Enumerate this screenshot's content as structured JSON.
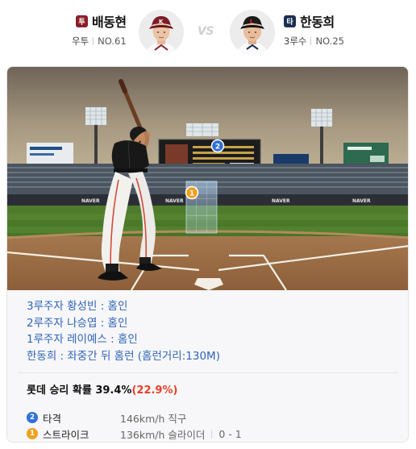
{
  "matchup": {
    "pitcher": {
      "role": "투",
      "name": "배동현",
      "position": "우투",
      "number": "NO.61",
      "role_color": "#8a1f2c"
    },
    "vs": "VS",
    "batter": {
      "role": "타",
      "name": "한동희",
      "position": "3루수",
      "number": "NO.25",
      "role_color": "#1b2f52"
    }
  },
  "stadium": {
    "pitch_markers": [
      {
        "label": "2",
        "color": "#2f6fd8"
      },
      {
        "label": "1",
        "color": "#f0a020"
      }
    ],
    "signs": [
      "NAVER",
      "NAVER",
      "NAVER",
      "NAVER"
    ]
  },
  "events": [
    "3루주자 황성빈 : 홈인",
    "2루주자 나승엽 : 홈인",
    "1루주자 레이예스 : 홈인",
    "한동희 : 좌중간 뒤 홈런 (홈런거리:130M)"
  ],
  "win_probability": {
    "label": "롯데 승리 확률",
    "value": "39.4%",
    "delta": "(22.9%)",
    "delta_color": "#e8402c"
  },
  "pitches": [
    {
      "num": "2",
      "color": "#2f6fd8",
      "result": "타격",
      "detail": "146km/h 직구",
      "count": ""
    },
    {
      "num": "1",
      "color": "#f0a020",
      "result": "스트라이크",
      "detail": "136km/h 슬라이더",
      "count": "0 - 1"
    }
  ]
}
